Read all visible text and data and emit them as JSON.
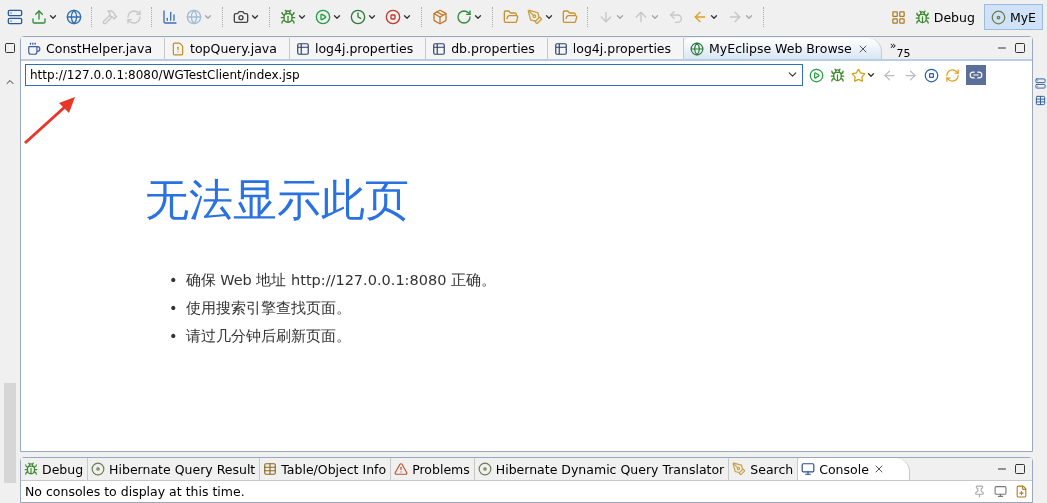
{
  "toolbar": [
    {
      "kind": "server",
      "disabled": false,
      "menu": false
    },
    {
      "kind": "deploy",
      "disabled": false,
      "menu": true
    },
    {
      "kind": "globe",
      "disabled": false,
      "menu": false
    },
    {
      "kind": "hammer",
      "disabled": true,
      "menu": false
    },
    {
      "kind": "refresh",
      "disabled": true,
      "menu": false
    },
    {
      "kind": "chart",
      "disabled": false,
      "menu": false
    },
    {
      "kind": "globe",
      "disabled": true,
      "menu": true
    },
    {
      "kind": "camera",
      "disabled": false,
      "menu": true
    },
    {
      "kind": "bug",
      "disabled": false,
      "menu": true
    },
    {
      "kind": "play",
      "disabled": false,
      "menu": true
    },
    {
      "kind": "clock",
      "disabled": false,
      "menu": true
    },
    {
      "kind": "stop",
      "disabled": false,
      "menu": true
    },
    {
      "kind": "package",
      "disabled": false,
      "menu": false
    },
    {
      "kind": "cycle",
      "disabled": false,
      "menu": true
    },
    {
      "kind": "folder",
      "disabled": false,
      "menu": false
    },
    {
      "kind": "pen",
      "disabled": false,
      "menu": true
    },
    {
      "kind": "folder",
      "disabled": false,
      "menu": false
    },
    {
      "kind": "down",
      "disabled": true,
      "menu": true
    },
    {
      "kind": "up",
      "disabled": true,
      "menu": true
    },
    {
      "kind": "back",
      "disabled": true,
      "menu": false
    },
    {
      "kind": "left",
      "disabled": false,
      "menu": true
    },
    {
      "kind": "right",
      "disabled": true,
      "menu": true
    }
  ],
  "perspectives": [
    {
      "label": "Debug",
      "selected": false
    },
    {
      "label": "MyE",
      "selected": true
    }
  ],
  "editor_tabs": [
    {
      "label": "ConstHelper.java",
      "kind": "java",
      "selected": false
    },
    {
      "label": "topQuery.java",
      "kind": "java-warning",
      "selected": false
    },
    {
      "label": "log4j.properties",
      "kind": "properties",
      "selected": false
    },
    {
      "label": "db.properties",
      "kind": "properties",
      "selected": false
    },
    {
      "label": "log4j.properties",
      "kind": "properties",
      "selected": false
    },
    {
      "label": "MyEclipse Web Browse",
      "kind": "browser",
      "selected": true
    }
  ],
  "overflow": {
    "marker": "»",
    "count": "75"
  },
  "browser": {
    "url": "http://127.0.0.1:8080/WGTestClient/index.jsp"
  },
  "page": {
    "heading": "无法显示此页",
    "bullets": [
      {
        "marker": "•",
        "text": "确保 Web 地址 http://127.0.0.1:8080 正确。"
      },
      {
        "marker": "•",
        "text": "使用搜索引擎查找页面。"
      },
      {
        "marker": "•",
        "text": "请过几分钟后刷新页面。"
      }
    ]
  },
  "bottom_tabs": [
    {
      "label": "Debug",
      "kind": "bug",
      "selected": false
    },
    {
      "label": "Hibernate Query Result",
      "kind": "hibernate",
      "selected": false
    },
    {
      "label": "Table/Object Info",
      "kind": "table",
      "selected": false
    },
    {
      "label": "Problems",
      "kind": "problems",
      "selected": false
    },
    {
      "label": "Hibernate Dynamic Query Translator",
      "kind": "hibernate",
      "selected": false
    },
    {
      "label": "Search",
      "kind": "search",
      "selected": false
    },
    {
      "label": "Console",
      "kind": "console",
      "selected": true
    }
  ],
  "console_message": "No consoles to display at this time."
}
